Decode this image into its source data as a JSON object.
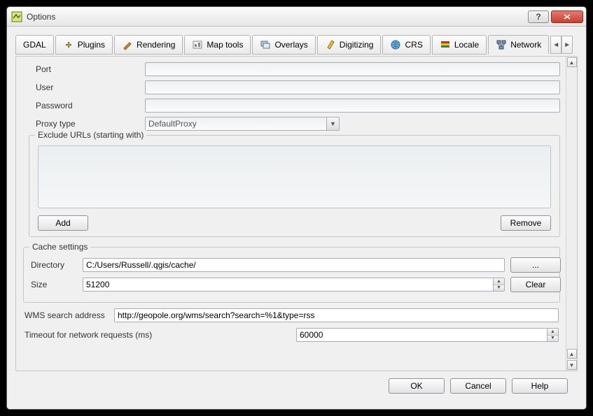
{
  "window": {
    "title": "Options"
  },
  "tabs": {
    "gdal": "GDAL",
    "plugins": "Plugins",
    "rendering": "Rendering",
    "maptools": "Map tools",
    "overlays": "Overlays",
    "digitizing": "Digitizing",
    "crs": "CRS",
    "locale": "Locale",
    "network": "Network"
  },
  "proxy": {
    "port_label": "Port",
    "user_label": "User",
    "password_label": "Password",
    "type_label": "Proxy type",
    "type_value": "DefaultProxy",
    "exclude_legend": "Exclude URLs (starting with)",
    "add_btn": "Add",
    "remove_btn": "Remove"
  },
  "cache": {
    "legend": "Cache settings",
    "dir_label": "Directory",
    "dir_value": "C:/Users/Russell/.qgis/cache/",
    "browse_btn": "...",
    "size_label": "Size",
    "size_value": "51200",
    "clear_btn": "Clear"
  },
  "wms": {
    "label": "WMS search address",
    "value": "http://geopole.org/wms/search?search=%1&type=rss"
  },
  "timeout": {
    "label": "Timeout for network requests (ms)",
    "value": "60000"
  },
  "buttons": {
    "ok": "OK",
    "cancel": "Cancel",
    "help": "Help"
  }
}
